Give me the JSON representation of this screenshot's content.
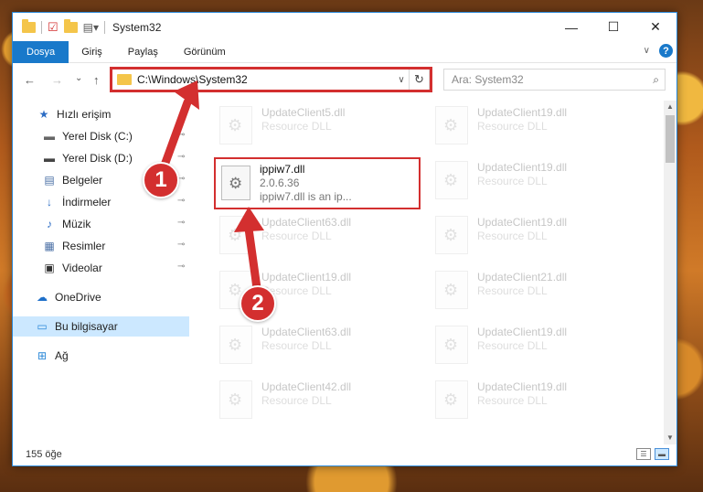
{
  "window": {
    "title": "System32",
    "controls": {
      "minimize": "—",
      "maximize": "☐",
      "close": "✕"
    }
  },
  "ribbon": {
    "tabs": [
      "Dosya",
      "Giriş",
      "Paylaş",
      "Görünüm"
    ],
    "active_tab": "Dosya",
    "help": "?",
    "collapse": "∨"
  },
  "address": {
    "back": "←",
    "forward": "→",
    "recent": "⌄",
    "up": "↑",
    "path": "C:\\Windows\\System32",
    "dropdown": "∨",
    "refresh": "↻"
  },
  "search": {
    "placeholder": "Ara: System32",
    "icon": "⌕"
  },
  "sidebar": {
    "items": [
      {
        "label": "Hızlı erişim",
        "icon": "star-icon",
        "glyph": "★",
        "color": "#2b6cc4"
      },
      {
        "label": "Yerel Disk (C:)",
        "icon": "drive-icon",
        "glyph": "▬",
        "color": "#666666",
        "pinned": true
      },
      {
        "label": "Yerel Disk (D:)",
        "icon": "drive-icon",
        "glyph": "▬",
        "color": "#444444",
        "pinned": true
      },
      {
        "label": "Belgeler",
        "icon": "documents-icon",
        "glyph": "▤",
        "color": "#4a6fa5",
        "pinned": true
      },
      {
        "label": "İndirmeler",
        "icon": "download-icon",
        "glyph": "↓",
        "color": "#2b6cc4",
        "pinned": true
      },
      {
        "label": "Müzik",
        "icon": "music-icon",
        "glyph": "♪",
        "color": "#2b6cc4",
        "pinned": true
      },
      {
        "label": "Resimler",
        "icon": "pictures-icon",
        "glyph": "▦",
        "color": "#4a6fa5",
        "pinned": true
      },
      {
        "label": "Videolar",
        "icon": "video-icon",
        "glyph": "▣",
        "color": "#333333",
        "pinned": true
      },
      {
        "label": "OneDrive",
        "icon": "cloud-icon",
        "glyph": "☁",
        "color": "#1e6fc9"
      },
      {
        "label": "Bu bilgisayar",
        "icon": "computer-icon",
        "glyph": "▭",
        "color": "#2b88d8",
        "selected": true
      },
      {
        "label": "Ağ",
        "icon": "network-icon",
        "glyph": "⊞",
        "color": "#2b88d8"
      }
    ],
    "pin_glyph": "📌"
  },
  "files": {
    "left": [
      {
        "name": "UpdateClient5.dll",
        "sub": "Resource DLL"
      },
      {
        "name": "UpdateClient63.dll",
        "sub": "Resource DLL"
      },
      {
        "name": "UpdateClient19.dll",
        "sub": "Resource DLL"
      },
      {
        "name": "UpdateClient63.dll",
        "sub": "Resource DLL"
      },
      {
        "name": "UpdateClient42.dll",
        "sub": "Resource DLL"
      }
    ],
    "right": [
      {
        "name": "UpdateClient19.dll",
        "sub": "Resource DLL"
      },
      {
        "name": "UpdateClient19.dll",
        "sub": "Resource DLL"
      },
      {
        "name": "UpdateClient19.dll",
        "sub": "Resource DLL"
      },
      {
        "name": "UpdateClient21.dll",
        "sub": "Resource DLL"
      },
      {
        "name": "UpdateClient19.dll",
        "sub": "Resource DLL"
      },
      {
        "name": "UpdateClient19.dll",
        "sub": "Resource DLL"
      }
    ],
    "featured": {
      "name": "ippiw7.dll",
      "version": "2.0.6.36",
      "description": "ippiw7.dll is an ip..."
    }
  },
  "status": {
    "count": "155 öğe"
  },
  "annotations": {
    "badge_1": "1",
    "badge_2": "2",
    "color": "#d32f2f"
  }
}
